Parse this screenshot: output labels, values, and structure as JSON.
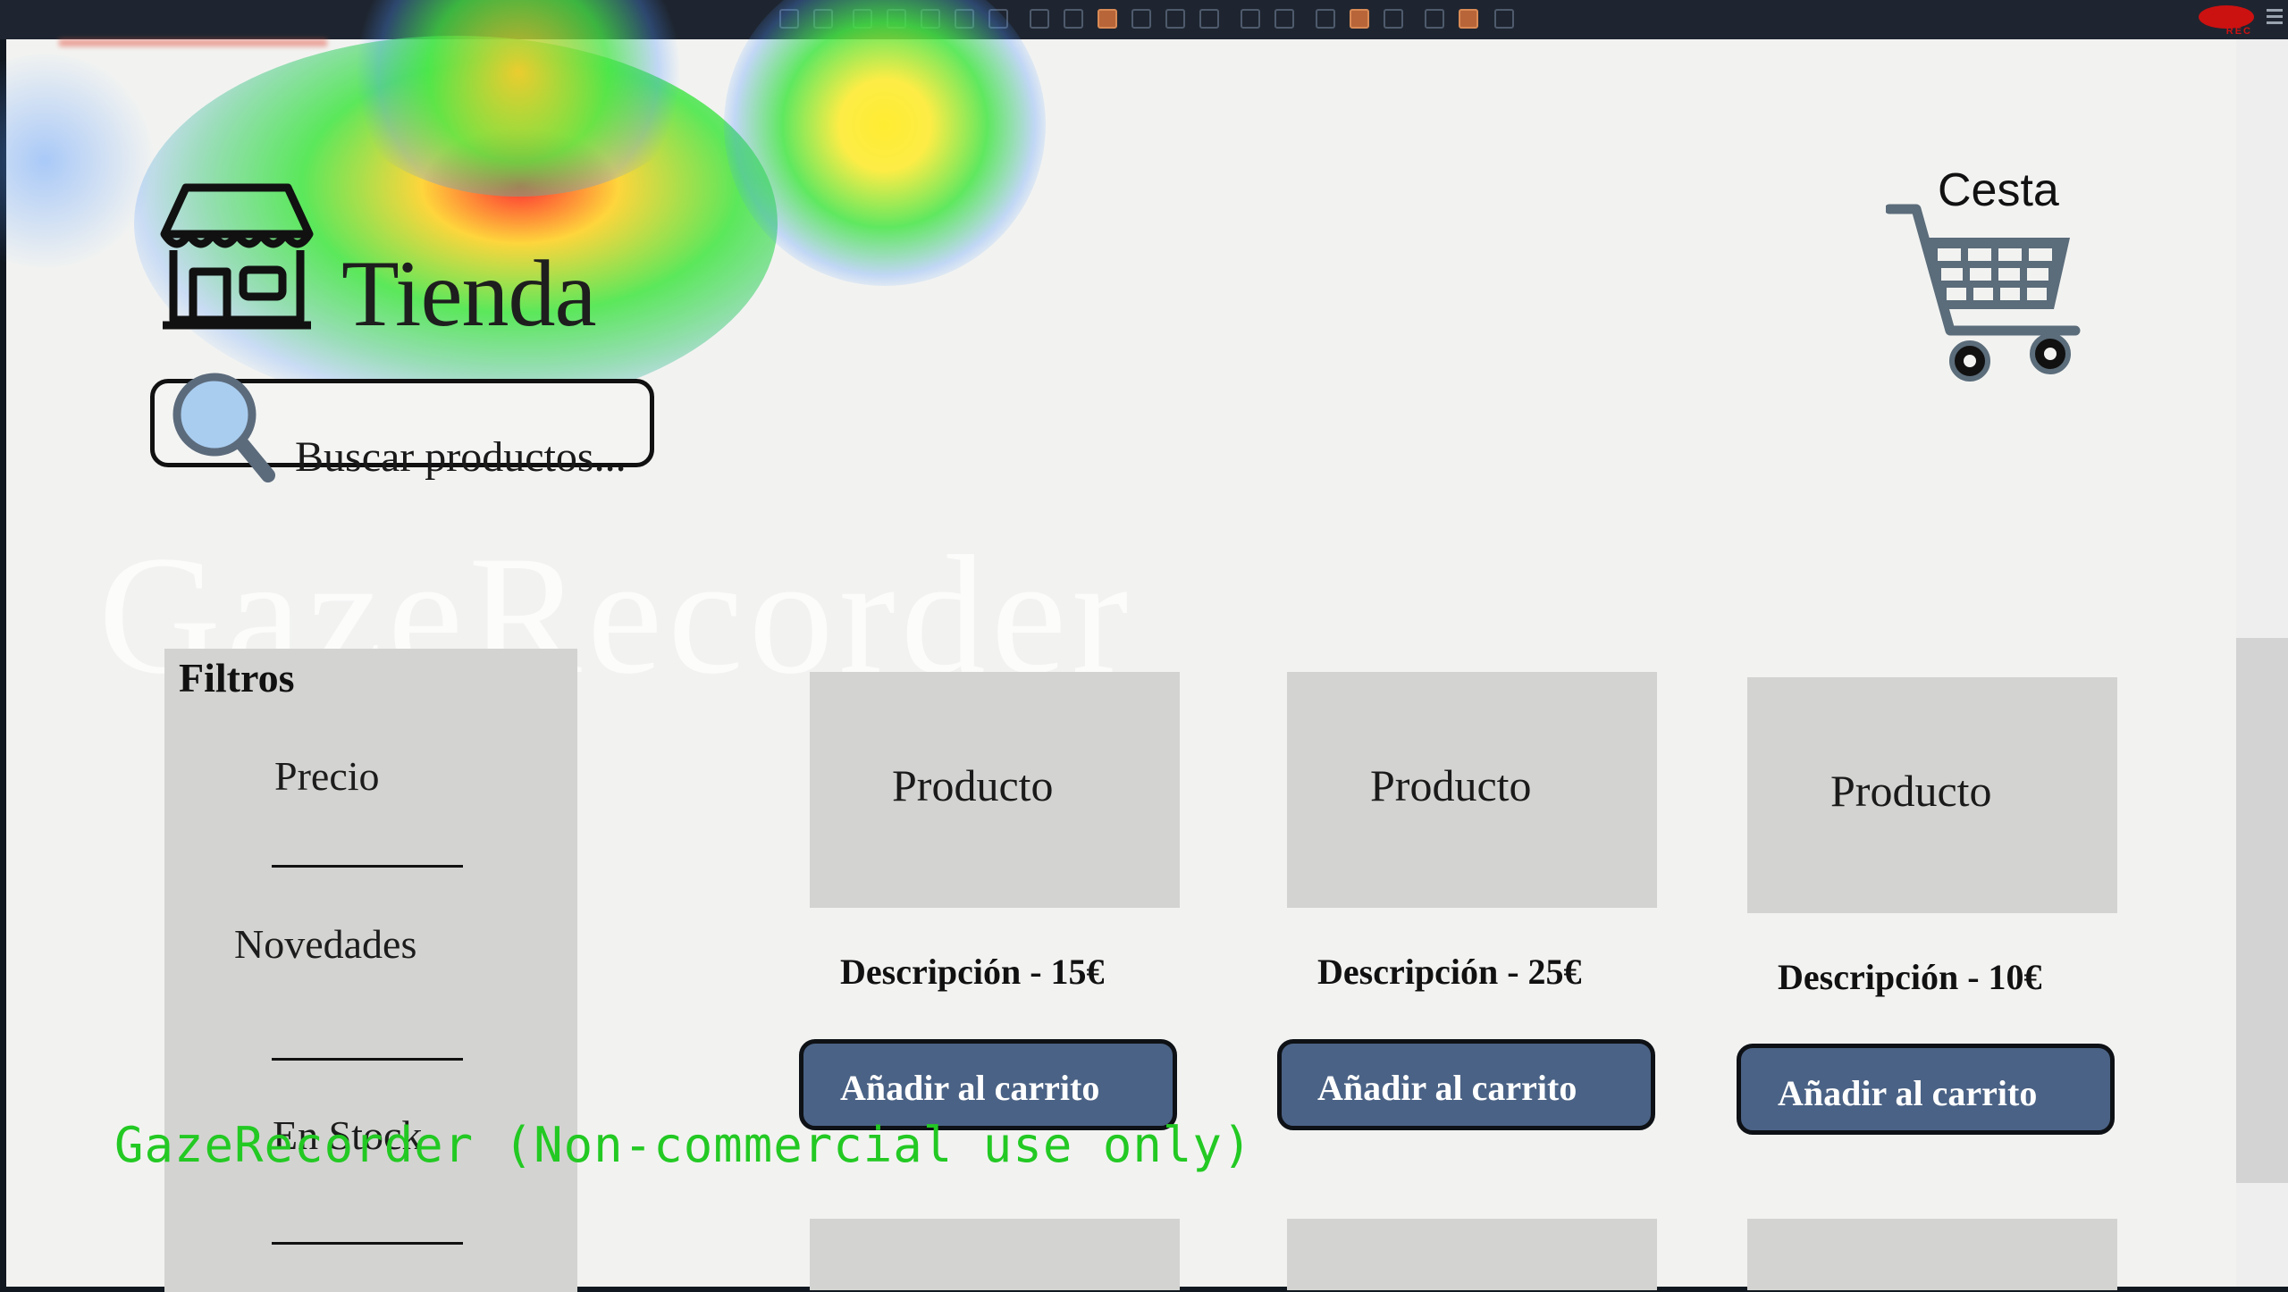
{
  "recorder": {
    "rec_label": "REC",
    "watermark": "GazeRecorder",
    "overlay": "GazeRecorder (Non-commercial use only)"
  },
  "header": {
    "title": "Tienda",
    "cart_label": "Cesta"
  },
  "search": {
    "placeholder": "Buscar productos..."
  },
  "filters": {
    "title": "Filtros",
    "items": [
      "Precio",
      "Novedades",
      "En Stock"
    ]
  },
  "products": [
    {
      "name": "Producto",
      "description": "Descripción - 15€",
      "button": "Añadir al carrito"
    },
    {
      "name": "Producto",
      "description": "Descripción - 25€",
      "button": "Añadir al carrito"
    },
    {
      "name": "Producto",
      "description": "Descripción - 10€",
      "button": "Añadir al carrito"
    }
  ],
  "colors": {
    "button": "#4a6285",
    "card": "#d3d4d1",
    "background": "#f2f3f1",
    "overlay_text": "#23c923"
  },
  "icons": [
    "store-icon",
    "search-icon",
    "cart-icon"
  ]
}
